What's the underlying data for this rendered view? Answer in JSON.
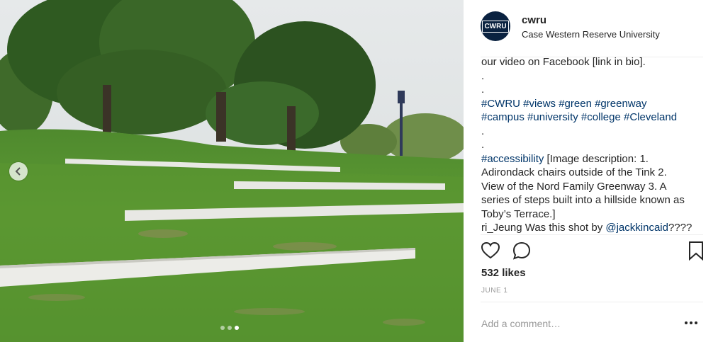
{
  "post": {
    "username": "cwru",
    "location": "Case Western Reserve University",
    "avatar_text": "CWRU",
    "caption_lines": [
      {
        "segments": [
          {
            "text": "our video on Facebook [link in bio].",
            "tag": false
          }
        ]
      },
      {
        "segments": [
          {
            "text": ".",
            "tag": false
          }
        ]
      },
      {
        "segments": [
          {
            "text": ".",
            "tag": false
          }
        ]
      },
      {
        "segments": [
          {
            "text": "#CWRU",
            "tag": true
          },
          {
            "text": " ",
            "tag": false
          },
          {
            "text": "#views",
            "tag": true
          },
          {
            "text": " ",
            "tag": false
          },
          {
            "text": "#green",
            "tag": true
          },
          {
            "text": " ",
            "tag": false
          },
          {
            "text": "#greenway",
            "tag": true
          }
        ]
      },
      {
        "segments": [
          {
            "text": "#campus",
            "tag": true
          },
          {
            "text": " ",
            "tag": false
          },
          {
            "text": "#university",
            "tag": true
          },
          {
            "text": " ",
            "tag": false
          },
          {
            "text": "#college",
            "tag": true
          },
          {
            "text": " ",
            "tag": false
          },
          {
            "text": "#Cleveland",
            "tag": true
          }
        ]
      },
      {
        "segments": [
          {
            "text": ".",
            "tag": false
          }
        ]
      },
      {
        "segments": [
          {
            "text": ".",
            "tag": false
          }
        ]
      },
      {
        "segments": [
          {
            "text": "#accessibility",
            "tag": true
          },
          {
            "text": " [Image description: 1.",
            "tag": false
          }
        ]
      },
      {
        "segments": [
          {
            "text": "Adirondack chairs outside of the Tink 2.",
            "tag": false
          }
        ]
      },
      {
        "segments": [
          {
            "text": "View of the Nord Family Greenway 3. A",
            "tag": false
          }
        ]
      },
      {
        "segments": [
          {
            "text": "series of steps built into a hillside known as",
            "tag": false
          }
        ]
      },
      {
        "segments": [
          {
            "text": "Toby’s Terrace.]",
            "tag": false
          }
        ]
      },
      {
        "segments": [
          {
            "text": "ri_Jeung",
            "tag": false
          },
          {
            "text": " Was this shot by ",
            "tag": false
          },
          {
            "text": "@jackkincaid",
            "tag": true
          },
          {
            "text": "????",
            "tag": false
          }
        ]
      }
    ],
    "likes": "532 likes",
    "date": "JUNE 1",
    "comment_placeholder": "Add a comment…"
  },
  "icons": {
    "like": "heart-icon",
    "comment": "comment-bubble-icon",
    "save": "bookmark-icon",
    "prev": "chevron-left-icon",
    "more": "more-options-icon"
  },
  "carousel": {
    "count": 3,
    "active": 3
  },
  "colors": {
    "hashtag": "#003569",
    "avatar_bg": "#0a2240",
    "text": "#262626",
    "muted": "#999999"
  }
}
